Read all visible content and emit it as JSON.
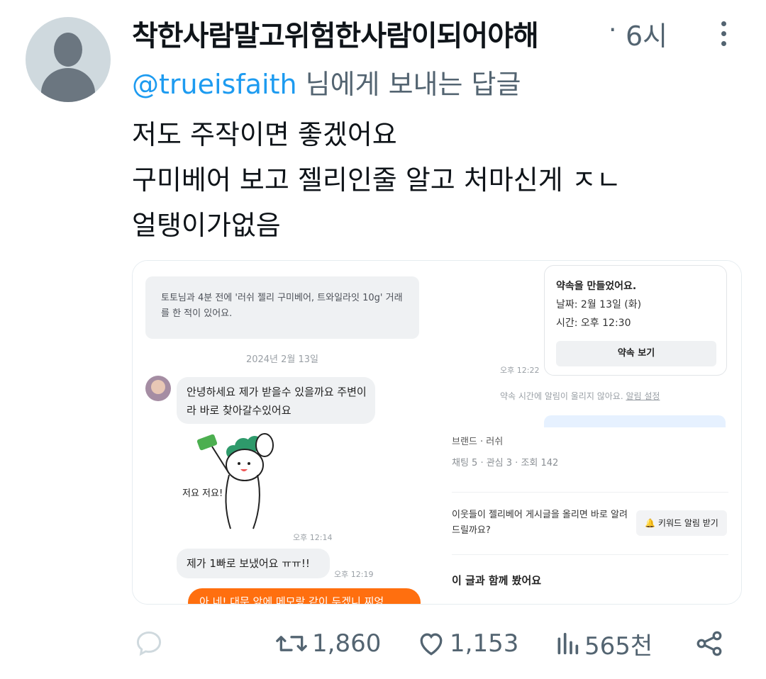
{
  "tweet": {
    "author_name": "착한사람말고위험한사람이되어야해",
    "separator": "·",
    "time": "6시",
    "reply_handle": "@trueisfaith",
    "reply_suffix": " 님에게 보내는 답글",
    "lines": [
      "저도 주작이면 좋겠어요",
      "구미베어 보고 젤리인줄 알고 처마신게 ㅈㄴ",
      "얼탱이가없음"
    ]
  },
  "media": {
    "left": {
      "system_message": "토토님과 4분 전에 '러쉬 젤리 구미베어, 트와일라잇 10g' 거래를 한 적이 있어요.",
      "date": "2024년 2월 13일",
      "bubble1": "안녕하세요 제가 받을수 있을까요 주변이라 바로 찾아갈수있어요",
      "sticker_text": "저요 저요!",
      "time1": "오후 12:14",
      "bubble2": "제가 1빠로 보냈어요 ㅠㅠ!!",
      "time2": "오후 12:19",
      "orange_bubble": "아 네! 대문 앞에 메모랑 같이 두겠니 찌엉"
    },
    "right_top": {
      "appointment_title": "약속을 만들었어요.",
      "appointment_date": "날짜: 2월 13일 (화)",
      "appointment_time": "시간: 오후 12:30",
      "view_button": "약속 보기",
      "time": "오후 12:22",
      "notify_text": "약속 시간에 알림이 울리지 않아요. ",
      "notify_link": "알림 설정"
    },
    "right_bottom": {
      "brand": "브랜드 · 러쉬",
      "stats": "채팅 5 · 관심 3 · 조회 142",
      "keyword_question": "이웃들이 젤리베어 게시글을 올리면 바로 알려드릴까요?",
      "keyword_button": "🔔 키워드 알림 받기",
      "seen_together": "이 글과 함께 봤어요"
    }
  },
  "actions": {
    "reply_icon": "comment-icon",
    "retweet_count": "1,860",
    "like_count": "1,153",
    "views_count": "565천",
    "share_icon": "share-icon"
  },
  "colors": {
    "link": "#1d9bf0",
    "muted": "#536471",
    "accent_orange": "#ff6f0f"
  }
}
